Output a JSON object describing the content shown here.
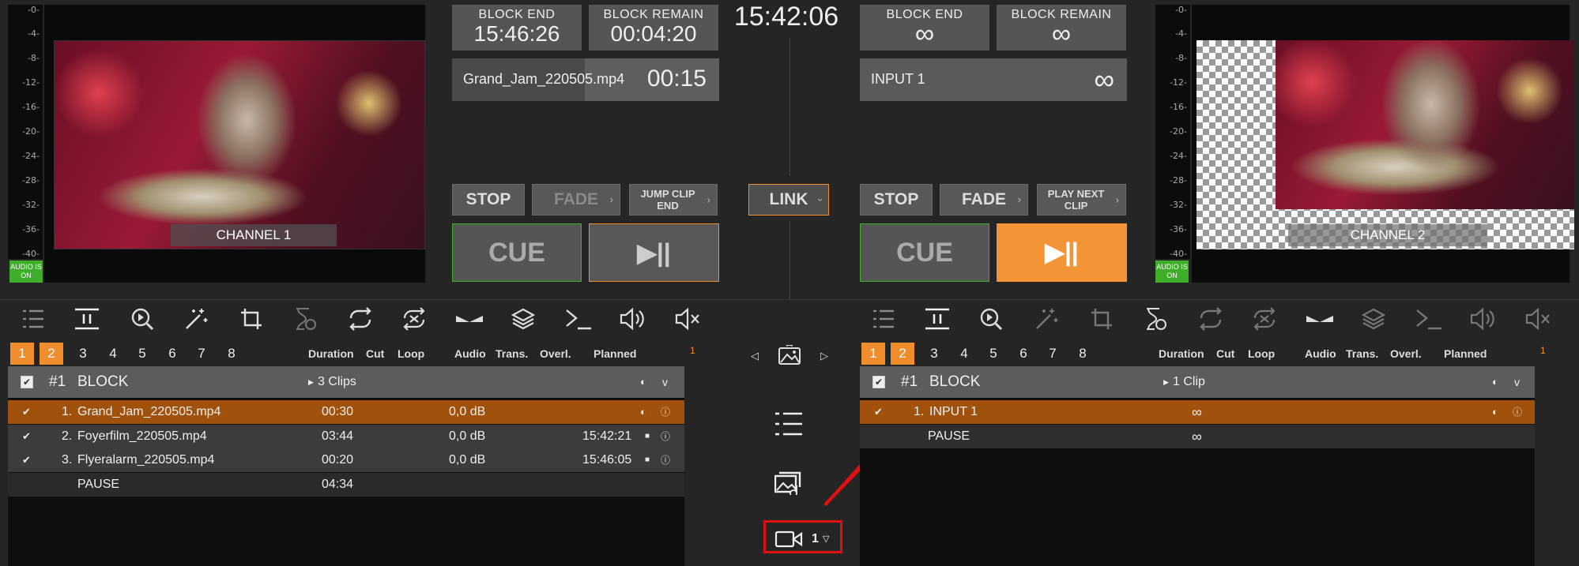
{
  "clock": "15:42:06",
  "meter_ticks": [
    "-0-",
    "-4-",
    "-8-",
    "-12-",
    "-16-",
    "-20-",
    "-24-",
    "-28-",
    "-32-",
    "-36-",
    "-40-"
  ],
  "audio_on": "AUDIO IS ON",
  "ch1": {
    "label": "CHANNEL 1",
    "block_end_label": "BLOCK END",
    "block_end": "15:46:26",
    "block_remain_label": "BLOCK REMAIN",
    "block_remain": "00:04:20",
    "clip": "Grand_Jam_220505.mp4",
    "clip_time": "00:15",
    "stop": "STOP",
    "fade": "FADE",
    "jump": "JUMP CLIP END",
    "cue": "CUE",
    "play": "▶||"
  },
  "ch2": {
    "label": "CHANNEL 2",
    "block_end_label": "BLOCK END",
    "block_end": "∞",
    "block_remain_label": "BLOCK REMAIN",
    "block_remain": "∞",
    "clip": "INPUT 1",
    "clip_time": "∞",
    "stop": "STOP",
    "fade": "FADE",
    "next": "PLAY NEXT CLIP",
    "cue": "CUE",
    "play": "▶||"
  },
  "link": "LINK",
  "tabs": [
    "1",
    "2",
    "3",
    "4",
    "5",
    "6",
    "7",
    "8"
  ],
  "columns": {
    "duration": "Duration",
    "cut": "Cut",
    "loop": "Loop",
    "audio": "Audio",
    "trans": "Trans.",
    "overl": "Overl.",
    "planned": "Planned"
  },
  "list1": {
    "block_num": "#1",
    "block_name": "BLOCK",
    "clips_count": "3 Clips",
    "marker": "1",
    "rows": [
      {
        "n": "1.",
        "name": "Grand_Jam_220505.mp4",
        "dur": "00:30",
        "audio": "0,0 dB",
        "planned": ""
      },
      {
        "n": "2.",
        "name": "Foyerfilm_220505.mp4",
        "dur": "03:44",
        "audio": "0,0 dB",
        "planned": "15:42:21"
      },
      {
        "n": "3.",
        "name": "Flyeralarm_220505.mp4",
        "dur": "00:20",
        "audio": "0,0 dB",
        "planned": "15:46:05"
      }
    ],
    "pause": "PAUSE",
    "pause_dur": "04:34"
  },
  "list2": {
    "block_num": "#1",
    "block_name": "BLOCK",
    "clips_count": "1 Clip",
    "marker": "1",
    "rows": [
      {
        "n": "1.",
        "name": "INPUT 1",
        "dur": "∞"
      }
    ],
    "pause": "PAUSE",
    "pause_dur": "∞"
  },
  "camera_select": "1",
  "colors": {
    "accent": "#f08d2c",
    "selected_row": "#a0520c",
    "highlight_red": "#e01010",
    "audio_green": "#3fae2a"
  }
}
